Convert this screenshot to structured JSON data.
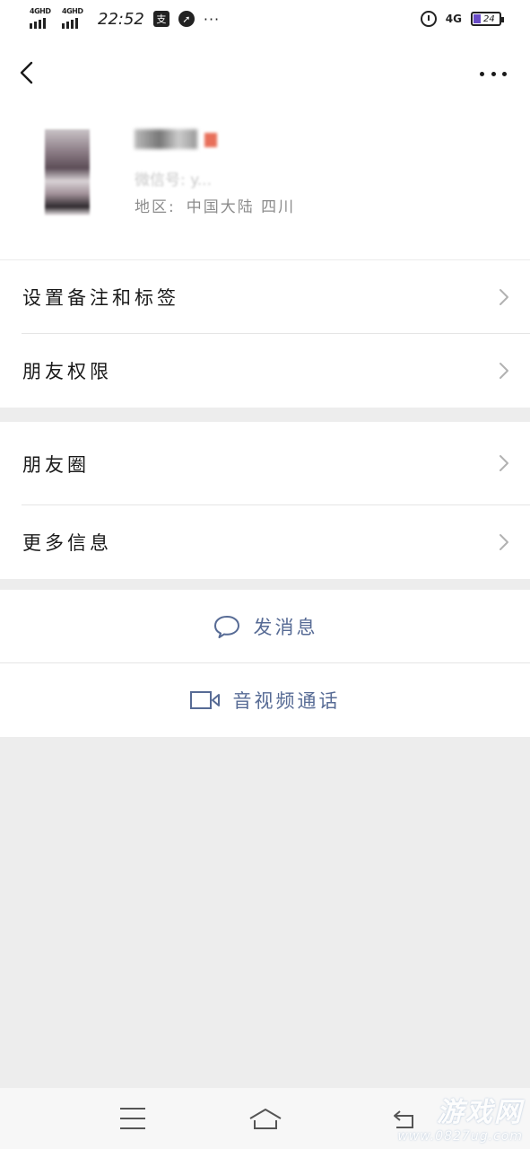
{
  "status_bar": {
    "sim1": "4GHD",
    "sim2": "4GHD",
    "time": "22:52",
    "app_icon_1": "支",
    "more": "···",
    "network": "4G",
    "battery": "24"
  },
  "top_nav": {
    "back_icon": "chevron-left-icon",
    "more_icon": "more-horizontal-icon"
  },
  "profile": {
    "wechat_id": "微信号: y...",
    "region_label": "地区:",
    "region_value": "中国大陆 四川"
  },
  "menu_group_1": [
    {
      "label": "设置备注和标签"
    },
    {
      "label": "朋友权限"
    }
  ],
  "menu_group_2": [
    {
      "label": "朋友圈"
    },
    {
      "label": "更多信息"
    }
  ],
  "actions": [
    {
      "label": "发消息",
      "icon": "chat-bubble-icon"
    },
    {
      "label": "音视频通话",
      "icon": "video-camera-icon"
    }
  ],
  "bottom_nav": {
    "menu_icon": "menu-icon",
    "home_icon": "home-icon",
    "back_icon": "back-icon"
  },
  "watermark": {
    "title": "游戏网",
    "url": "www.0827ug.com"
  },
  "colors": {
    "link": "#576b95",
    "background": "#ededed",
    "surface": "#ffffff"
  }
}
